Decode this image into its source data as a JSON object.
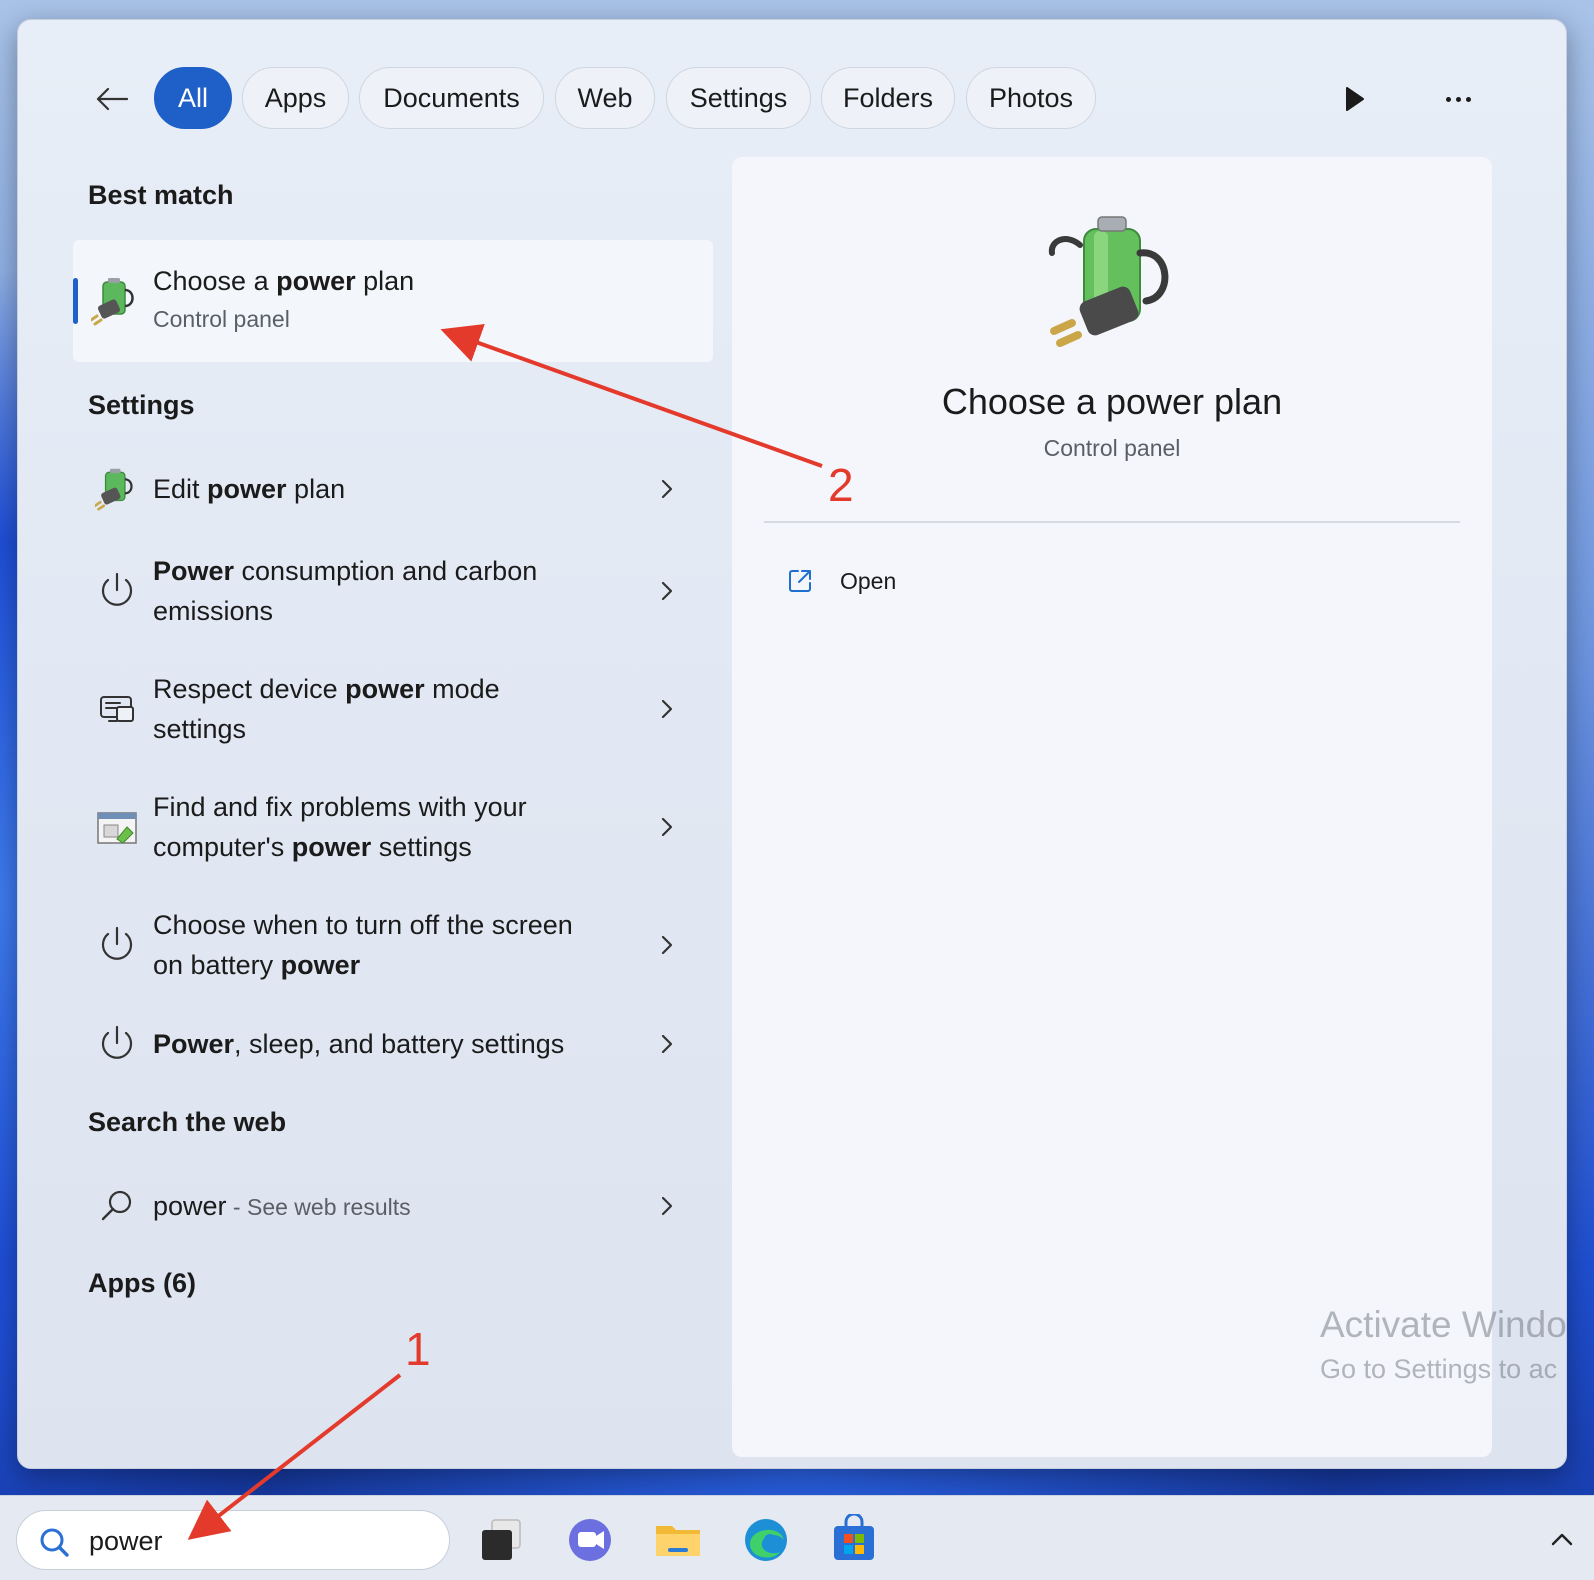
{
  "filters": {
    "back_icon": "arrow-left-icon",
    "items": [
      {
        "label": "All",
        "active": true
      },
      {
        "label": "Apps"
      },
      {
        "label": "Documents"
      },
      {
        "label": "Web"
      },
      {
        "label": "Settings"
      },
      {
        "label": "Folders"
      },
      {
        "label": "Photos"
      }
    ],
    "play_icon": "play-icon",
    "more_icon": "more-horizontal-icon"
  },
  "best_match": {
    "heading": "Best match",
    "title_pre": "Choose a ",
    "title_bold": "power",
    "title_post": " plan",
    "subtitle": "Control panel",
    "icon": "battery-plug-icon"
  },
  "settings": {
    "heading": "Settings",
    "items": [
      {
        "pre": "Edit ",
        "bold": "power",
        "post": " plan",
        "icon": "battery-plug-icon"
      },
      {
        "pre": "",
        "bold": "Power",
        "post": " consumption and carbon emissions",
        "icon": "power-icon"
      },
      {
        "pre": "Respect device ",
        "bold": "power",
        "post": " mode settings",
        "icon": "device-settings-icon"
      },
      {
        "pre": "Find and fix problems with your computer's ",
        "bold": "power",
        "post": " settings",
        "icon": "troubleshoot-icon"
      },
      {
        "pre": "Choose when to turn off the screen on battery ",
        "bold": "power",
        "post": "",
        "icon": "power-icon"
      },
      {
        "pre": "",
        "bold": "Power",
        "post": ", sleep, and battery settings",
        "icon": "power-icon"
      }
    ]
  },
  "web": {
    "heading": "Search the web",
    "query": "power",
    "suffix": " - See web results",
    "icon": "search-icon"
  },
  "apps": {
    "heading": "Apps (6)"
  },
  "preview": {
    "title": "Choose a power plan",
    "subtitle": "Control panel",
    "open_label": "Open",
    "open_icon": "open-external-icon"
  },
  "watermark": {
    "line1": "Activate Windo",
    "line2": "Go to Settings to ac"
  },
  "annotations": {
    "label_1": "1",
    "label_2": "2",
    "color": "#e43a2c"
  },
  "taskbar": {
    "search_value": "power",
    "apps": [
      "task-view-icon",
      "teams-chat-icon",
      "file-explorer-icon",
      "edge-icon",
      "store-icon"
    ],
    "tray_icon": "chevron-up-icon"
  },
  "colors": {
    "accent": "#1f5fc8",
    "annotation": "#e43a2c"
  }
}
